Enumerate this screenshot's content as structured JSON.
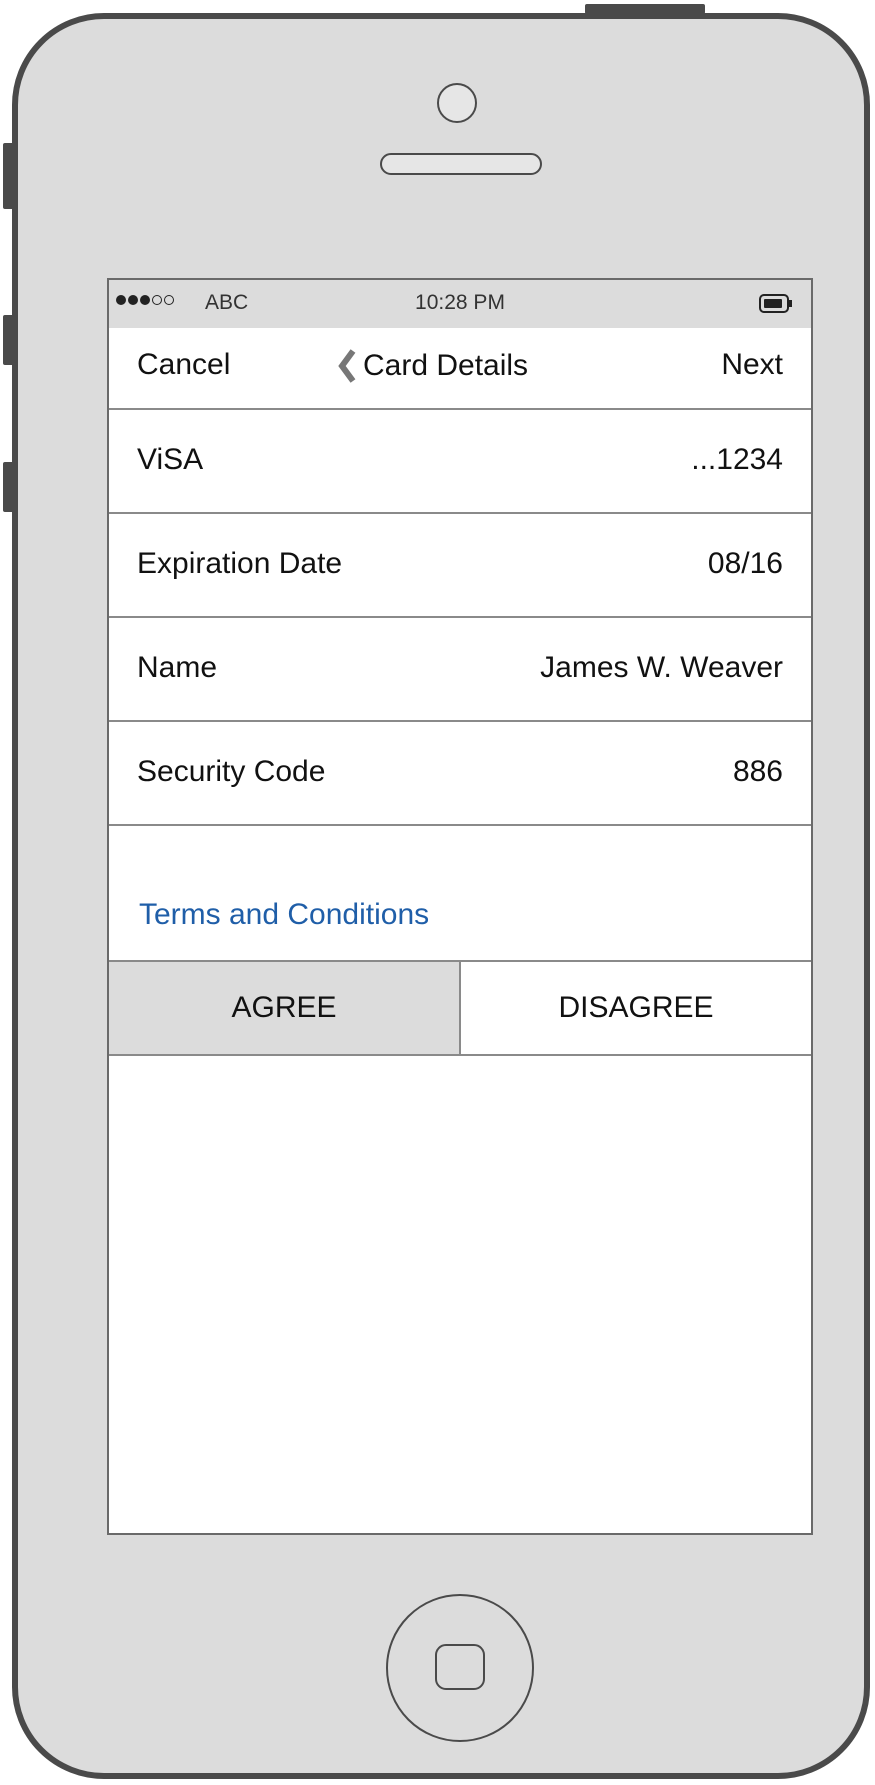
{
  "status_bar": {
    "signal_dots_filled": 3,
    "signal_dots_total": 5,
    "carrier": "ABC",
    "time": "10:28 PM",
    "battery_icon": "battery-icon"
  },
  "nav": {
    "cancel_label": "Cancel",
    "back_icon": "chevron-left-icon",
    "title": "Card Details",
    "next_label": "Next"
  },
  "card": {
    "rows": [
      {
        "label": "ViSA",
        "value": "...1234"
      },
      {
        "label": "Expiration Date",
        "value": "08/16"
      },
      {
        "label": "Name",
        "value": "James W. Weaver"
      },
      {
        "label": "Security Code",
        "value": "886"
      }
    ]
  },
  "terms": {
    "link_label": "Terms and Conditions",
    "link_color": "#1f5ea8",
    "agree_label": "AGREE",
    "disagree_label": "DISAGREE",
    "selected": "AGREE"
  },
  "device": {
    "camera_icon": "camera-icon",
    "speaker_icon": "speaker-icon",
    "home_icon": "home-button-icon"
  },
  "colors": {
    "device_body": "#dcdcdc",
    "device_outline": "#4a4a4a",
    "screen_bg": "#ffffff",
    "divider": "#8a8a8a",
    "selected_segment": "#dcdcdc"
  }
}
